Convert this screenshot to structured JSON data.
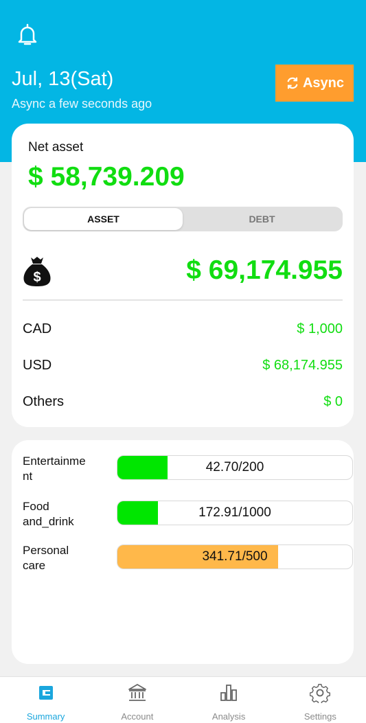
{
  "header": {
    "date": "Jul, 13(Sat)",
    "sync_status": "Async a few seconds ago",
    "async_button": "Async"
  },
  "net_asset": {
    "label": "Net asset",
    "value": "$ 58,739.209"
  },
  "tabs": [
    {
      "label": "ASSET",
      "active": true
    },
    {
      "label": "DEBT",
      "active": false
    }
  ],
  "asset_total": "$ 69,174.955",
  "currencies": [
    {
      "name": "CAD",
      "value": "$ 1,000"
    },
    {
      "name": "USD",
      "value": "$ 68,174.955"
    },
    {
      "name": "Others",
      "value": "$ 0"
    }
  ],
  "budgets": [
    {
      "name": "Entertainme\nnt",
      "text": "42.70/200",
      "fraction": 0.2135,
      "color": "#00e600"
    },
    {
      "name": "Food\nand_drink",
      "text": "172.91/1000",
      "fraction": 0.1729,
      "color": "#00e600"
    },
    {
      "name": "Personal\ncare",
      "text": "341.71/500",
      "fraction": 0.6834,
      "color": "#ffb84a"
    }
  ],
  "nav": [
    {
      "label": "Summary",
      "icon": "wallet-icon",
      "active": true
    },
    {
      "label": "Account",
      "icon": "bank-icon",
      "active": false
    },
    {
      "label": "Analysis",
      "icon": "bar-chart-icon",
      "active": false
    },
    {
      "label": "Settings",
      "icon": "gear-icon",
      "active": false
    }
  ],
  "colors": {
    "header_bg": "#03b6e4",
    "accent_orange": "#ff9d2e",
    "positive_green": "#11dd11",
    "nav_active": "#1aa6dd"
  }
}
